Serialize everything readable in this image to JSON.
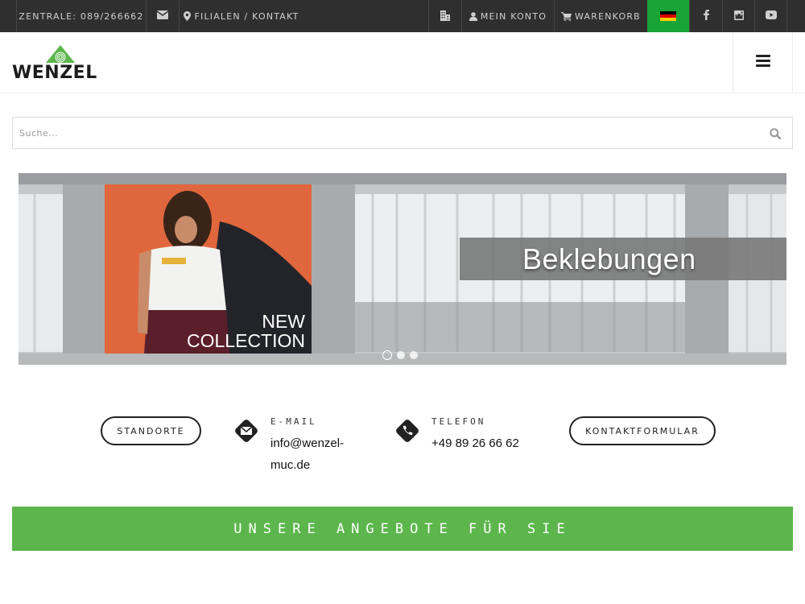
{
  "topbar": {
    "phone": "ZENTRALE: 089/266662",
    "email_icon": "envelope-icon",
    "locations": "FILIALEN / KONTAKT",
    "building_icon": "building-icon",
    "account": "MEIN KONTO",
    "cart": "WARENKORB",
    "flag_colors": [
      "#000000",
      "#dd0000",
      "#ffce00"
    ],
    "social": [
      "facebook-icon",
      "instagram-icon",
      "youtube-icon"
    ]
  },
  "header": {
    "logo_text": "WENZEL",
    "logo_color": "#5cb64c",
    "menu_icon": "hamburger-icon"
  },
  "search": {
    "placeholder": "Suche...",
    "value": ""
  },
  "slider": {
    "banner_text": "Beklebungen",
    "poster_line1": "NEW",
    "poster_line2": "COLLECTION",
    "slide_count": 3,
    "active_slide": 1
  },
  "contact": {
    "locations_button": "STANDORTE",
    "email_label": "E-MAIL",
    "email_line1": "info@wenzel-",
    "email_line2": "muc.de",
    "phone_label": "TELEFON",
    "phone_value": "+49 89 26 66 62",
    "form_button": "KONTAKTFORMULAR"
  },
  "offers": {
    "title": "UNSERE ANGEBOTE FÜR SIE",
    "color": "#5cb64c"
  }
}
